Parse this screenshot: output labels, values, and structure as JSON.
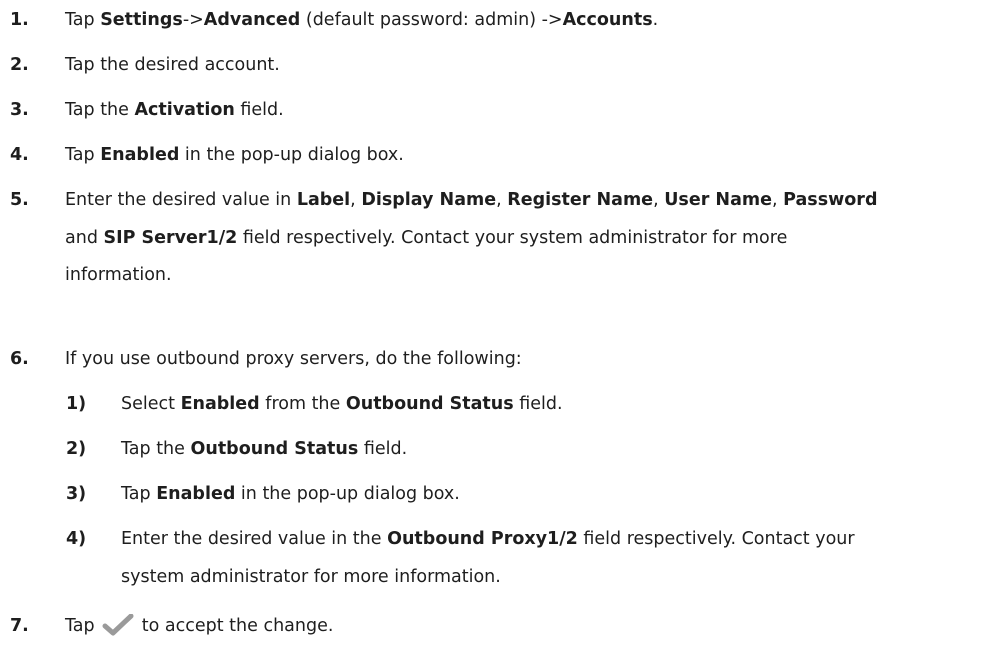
{
  "steps": [
    {
      "num": "1.",
      "parts": [
        {
          "t": "Tap "
        },
        {
          "t": "Settings",
          "b": true
        },
        {
          "t": "->"
        },
        {
          "t": "Advanced",
          "b": true
        },
        {
          "t": " (default password: admin) ->"
        },
        {
          "t": "Accounts",
          "b": true
        },
        {
          "t": "."
        }
      ]
    },
    {
      "num": "2.",
      "parts": [
        {
          "t": "Tap the desired account."
        }
      ]
    },
    {
      "num": "3.",
      "parts": [
        {
          "t": "Tap the "
        },
        {
          "t": "Activation",
          "b": true
        },
        {
          "t": " field."
        }
      ]
    },
    {
      "num": "4.",
      "parts": [
        {
          "t": "Tap "
        },
        {
          "t": "Enabled",
          "b": true
        },
        {
          "t": " in the pop-up dialog box."
        }
      ]
    },
    {
      "num": "5.",
      "lines": [
        [
          {
            "t": "Enter the desired value in "
          },
          {
            "t": "Label",
            "b": true
          },
          {
            "t": ", "
          },
          {
            "t": "Display Name",
            "b": true
          },
          {
            "t": ", "
          },
          {
            "t": "Register Name",
            "b": true
          },
          {
            "t": ", "
          },
          {
            "t": "User Name",
            "b": true
          },
          {
            "t": ", "
          },
          {
            "t": "Password",
            "b": true
          }
        ],
        [
          {
            "t": "and "
          },
          {
            "t": "SIP Server1/2",
            "b": true
          },
          {
            "t": " field respectively. Contact your system administrator for more"
          }
        ],
        [
          {
            "t": "information."
          }
        ]
      ]
    },
    {
      "num": "6.",
      "parts": [
        {
          "t": "If you use outbound proxy servers, do the following:"
        }
      ]
    },
    {
      "num": "7.",
      "parts": [
        {
          "t": "Tap "
        },
        {
          "icon": "check-icon"
        },
        {
          "t": " to accept the change."
        }
      ]
    }
  ],
  "substeps": [
    {
      "num": "1)",
      "parts": [
        {
          "t": "Select "
        },
        {
          "t": "Enabled",
          "b": true
        },
        {
          "t": " from the "
        },
        {
          "t": "Outbound Status",
          "b": true
        },
        {
          "t": " field."
        }
      ]
    },
    {
      "num": "2)",
      "parts": [
        {
          "t": "Tap the "
        },
        {
          "t": "Outbound Status",
          "b": true
        },
        {
          "t": " field."
        }
      ]
    },
    {
      "num": "3)",
      "parts": [
        {
          "t": "Tap "
        },
        {
          "t": "Enabled",
          "b": true
        },
        {
          "t": " in the pop-up dialog box."
        }
      ]
    },
    {
      "num": "4)",
      "lines": [
        [
          {
            "t": "Enter the desired value in the "
          },
          {
            "t": "Outbound Proxy1/2",
            "b": true
          },
          {
            "t": " field respectively. Contact your"
          }
        ],
        [
          {
            "t": "system administrator for more information."
          }
        ]
      ]
    }
  ],
  "colors": {
    "text": "#1e1e1e",
    "check_icon": "#9a9a9a"
  }
}
